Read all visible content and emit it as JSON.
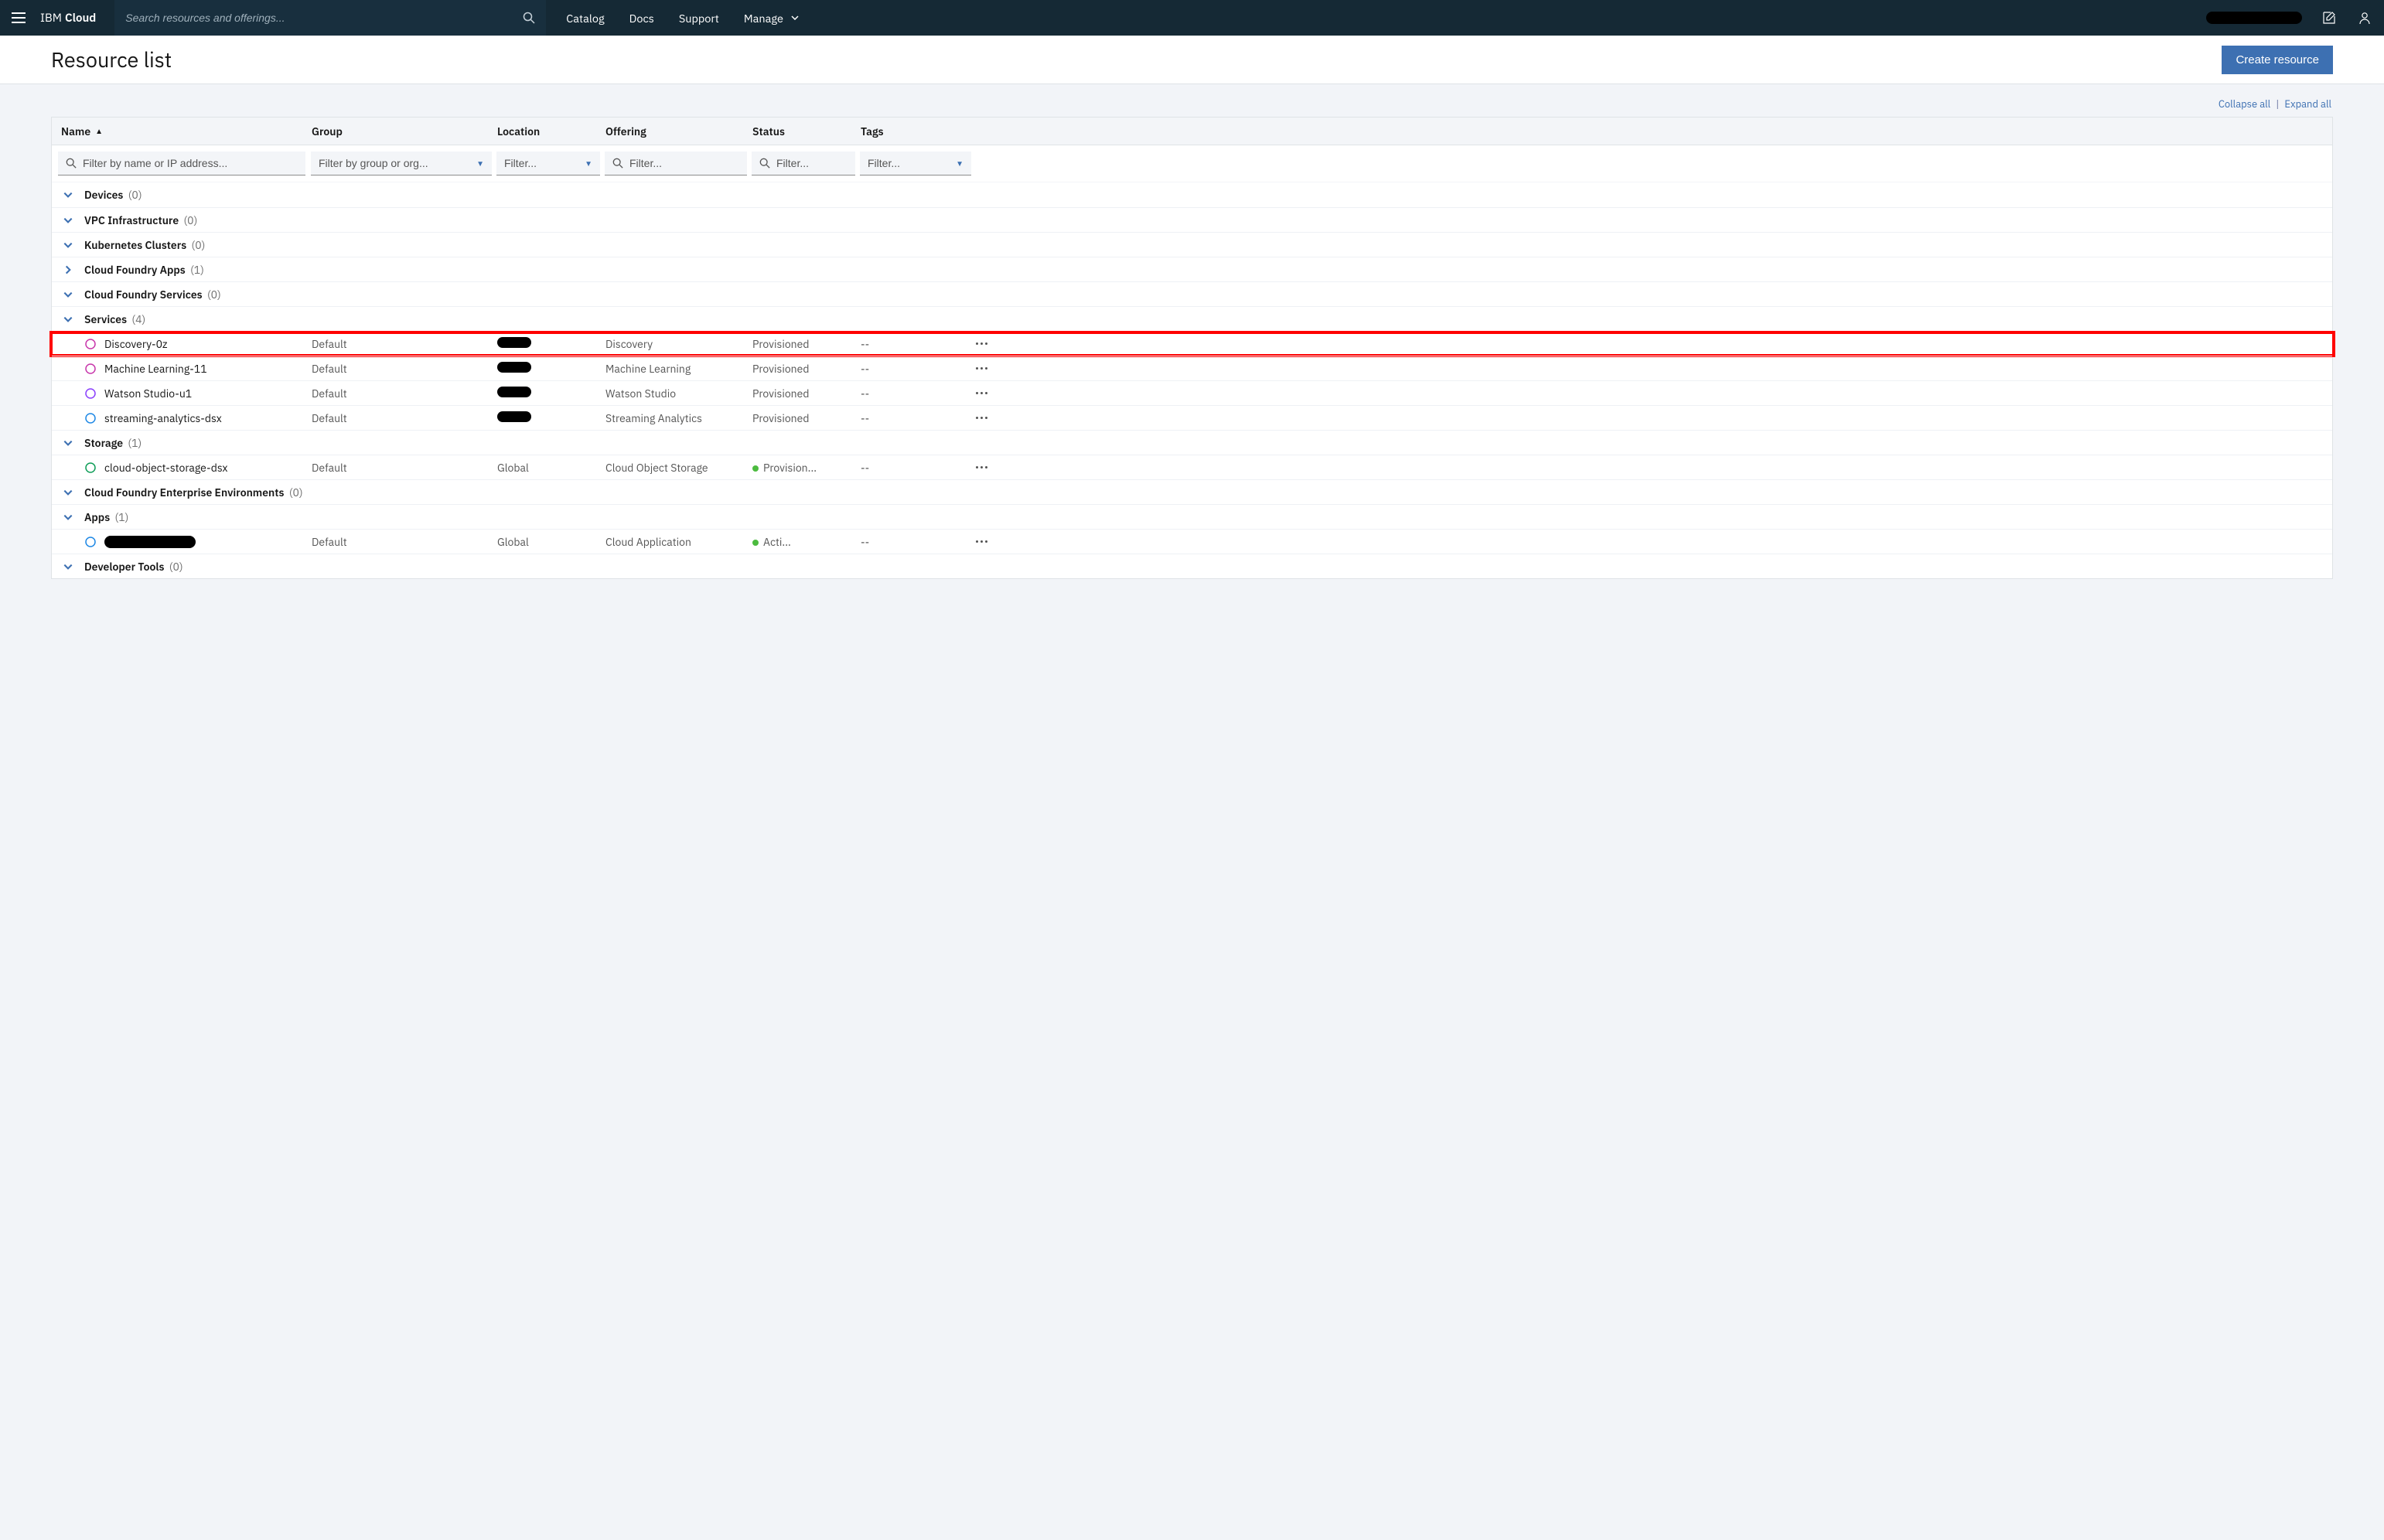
{
  "header": {
    "brand_light": "IBM",
    "brand_bold": "Cloud",
    "search_placeholder": "Search resources and offerings...",
    "nav": {
      "catalog": "Catalog",
      "docs": "Docs",
      "support": "Support",
      "manage": "Manage"
    }
  },
  "page": {
    "title": "Resource list",
    "create_button": "Create resource",
    "collapse_all": "Collapse all",
    "expand_all": "Expand all"
  },
  "columns": {
    "name": "Name",
    "group": "Group",
    "location": "Location",
    "offering": "Offering",
    "status": "Status",
    "tags": "Tags"
  },
  "filters": {
    "name_placeholder": "Filter by name or IP address...",
    "group_placeholder": "Filter by group or org...",
    "location_placeholder": "Filter...",
    "offering_placeholder": "Filter...",
    "status_placeholder": "Filter...",
    "tags_placeholder": "Filter..."
  },
  "groups": [
    {
      "id": "devices",
      "label": "Devices",
      "count": "(0)",
      "expanded": true,
      "items": []
    },
    {
      "id": "vpc",
      "label": "VPC Infrastructure",
      "count": "(0)",
      "expanded": true,
      "items": []
    },
    {
      "id": "k8s",
      "label": "Kubernetes Clusters",
      "count": "(0)",
      "expanded": true,
      "items": []
    },
    {
      "id": "cfapps",
      "label": "Cloud Foundry Apps",
      "count": "(1)",
      "expanded": false,
      "items": []
    },
    {
      "id": "cfsvc",
      "label": "Cloud Foundry Services",
      "count": "(0)",
      "expanded": true,
      "items": []
    },
    {
      "id": "svc",
      "label": "Services",
      "count": "(4)",
      "expanded": true,
      "items": [
        {
          "name": "Discovery-0z",
          "group": "Default",
          "location": "[redacted]",
          "offering": "Discovery",
          "status": "Provisioned",
          "tags": "--",
          "highlight": true,
          "icon_color": "#c837ab"
        },
        {
          "name": "Machine Learning-11",
          "group": "Default",
          "location": "[redacted]",
          "offering": "Machine Learning",
          "status": "Provisioned",
          "tags": "--",
          "icon_color": "#c837ab"
        },
        {
          "name": "Watson Studio-u1",
          "group": "Default",
          "location": "[redacted]",
          "offering": "Watson Studio",
          "status": "Provisioned",
          "tags": "--",
          "icon_color": "#8a3ffc"
        },
        {
          "name": "streaming-analytics-dsx",
          "group": "Default",
          "location": "[redacted]",
          "offering": "Streaming Analytics",
          "status": "Provisioned",
          "tags": "--",
          "icon_color": "#1e88e5"
        }
      ]
    },
    {
      "id": "storage",
      "label": "Storage",
      "count": "(1)",
      "expanded": true,
      "items": [
        {
          "name": "cloud-object-storage-dsx",
          "group": "Default",
          "location": "Global",
          "offering": "Cloud Object Storage",
          "status": "Provision...",
          "status_dot": true,
          "tags": "--",
          "icon_color": "#0f9d58"
        }
      ]
    },
    {
      "id": "cfee",
      "label": "Cloud Foundry Enterprise Environments",
      "count": "(0)",
      "expanded": true,
      "items": []
    },
    {
      "id": "apps",
      "label": "Apps",
      "count": "(1)",
      "expanded": true,
      "items": [
        {
          "name": "[redacted]",
          "name_redacted": true,
          "group": "Default",
          "location": "Global",
          "offering": "Cloud Application",
          "status": "Acti...",
          "status_dot": true,
          "tags": "--",
          "icon_color": "#1e88e5"
        }
      ]
    },
    {
      "id": "devtools",
      "label": "Developer Tools",
      "count": "(0)",
      "expanded": true,
      "items": []
    }
  ]
}
